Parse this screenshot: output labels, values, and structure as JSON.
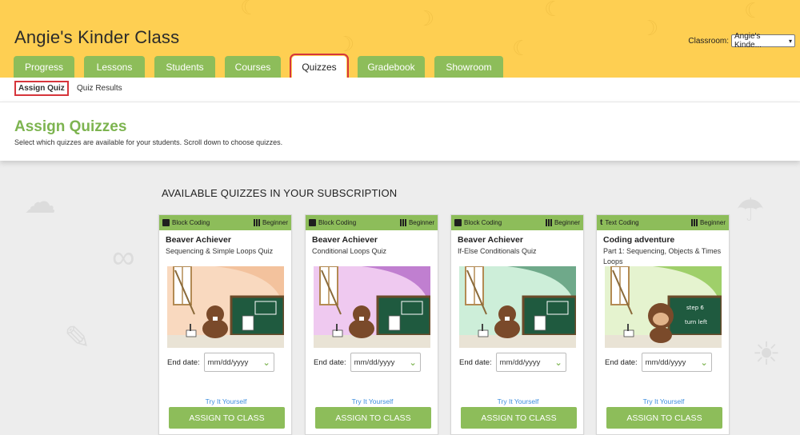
{
  "header": {
    "class_title": "Angie's Kinder Class",
    "classroom_label": "Classroom:",
    "classroom_value": "Angie's Kinde..."
  },
  "tabs": [
    {
      "label": "Progress"
    },
    {
      "label": "Lessons"
    },
    {
      "label": "Students"
    },
    {
      "label": "Courses"
    },
    {
      "label": "Quizzes"
    },
    {
      "label": "Gradebook"
    },
    {
      "label": "Showroom"
    }
  ],
  "subnav": {
    "assign_label": "Assign Quiz",
    "results_label": "Quiz Results"
  },
  "page": {
    "title": "Assign Quizzes",
    "subtitle": "Select which quizzes are available for your students. Scroll down to choose quizzes."
  },
  "section_heading": "AVAILABLE QUIZZES IN YOUR SUBSCRIPTION",
  "cards": [
    {
      "category": "Block Coding",
      "category_icon": "cube-icon",
      "level": "Beginner",
      "title": "Beaver Achiever",
      "desc": "Sequencing & Simple Loops Quiz",
      "image_theme": "#f9d9bf",
      "image_accent": "#f3c29d",
      "end_label": "End date:",
      "date_placeholder": "mm/dd/yyyy",
      "try_label": "Try It Yourself",
      "button_label": "ASSIGN TO CLASS"
    },
    {
      "category": "Block Coding",
      "category_icon": "cube-icon",
      "level": "Beginner",
      "title": "Beaver Achiever",
      "desc": "Conditional Loops Quiz",
      "image_theme": "#efc9f0",
      "image_accent": "#c07fd0",
      "end_label": "End date:",
      "date_placeholder": "mm/dd/yyyy",
      "try_label": "Try It Yourself",
      "button_label": "ASSIGN TO CLASS"
    },
    {
      "category": "Block Coding",
      "category_icon": "cube-icon",
      "level": "Beginner",
      "title": "Beaver Achiever",
      "desc": "If-Else Conditionals Quiz",
      "image_theme": "#cdeed9",
      "image_accent": "#6fa98a",
      "end_label": "End date:",
      "date_placeholder": "mm/dd/yyyy",
      "try_label": "Try It Yourself",
      "button_label": "ASSIGN TO CLASS"
    },
    {
      "category": "Text Coding",
      "category_icon": "text-t-icon",
      "level": "Beginner",
      "title": "Coding adventure",
      "desc": "Part 1: Sequencing, Objects & Times Loops",
      "image_theme": "#e5f3cf",
      "image_accent": "#9fcf6a",
      "end_label": "End date:",
      "date_placeholder": "mm/dd/yyyy",
      "try_label": "Try It Yourself",
      "button_label": "ASSIGN TO CLASS"
    }
  ],
  "board_text": [
    "step 6",
    "turn left"
  ],
  "colors": {
    "header_yellow": "#fecf52",
    "accent_green": "#8dbd5a",
    "title_green": "#7db450",
    "highlight_red": "#d6353b",
    "link_blue": "#3c8dde"
  }
}
